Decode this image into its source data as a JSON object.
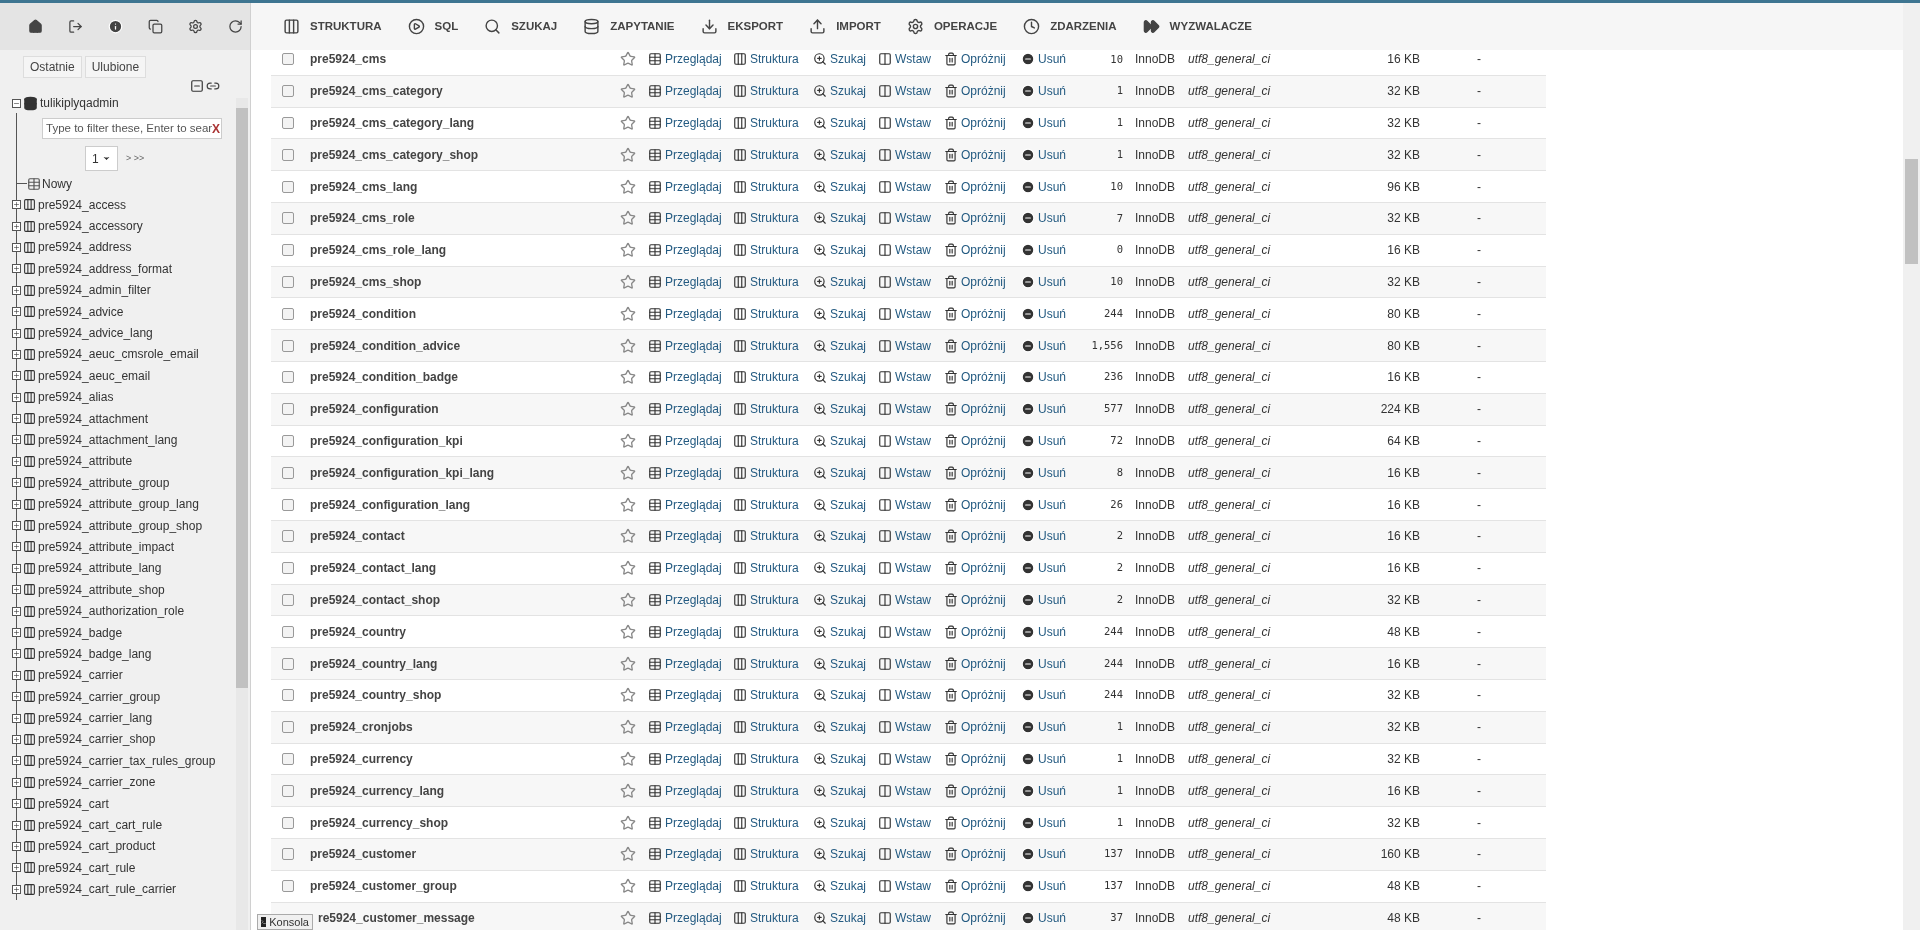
{
  "sidebar": {
    "tabs": [
      {
        "label": "Ostatnie"
      },
      {
        "label": "Ulubione"
      }
    ],
    "database": {
      "name": "tulikiplyqadmin",
      "expanded": true
    },
    "filter": {
      "placeholder": "Type to filter these, Enter to sear",
      "clear": "X"
    },
    "pager": {
      "page": "1",
      "next": "> >>"
    },
    "new_item": "Nowy",
    "tables": [
      {
        "name": "pre5924_access",
        "expanded": false
      },
      {
        "name": "pre5924_accessory",
        "expanded": false
      },
      {
        "name": "pre5924_address",
        "expanded": false
      },
      {
        "name": "pre5924_address_format",
        "expanded": false
      },
      {
        "name": "pre5924_admin_filter",
        "expanded": false
      },
      {
        "name": "pre5924_advice",
        "expanded": false
      },
      {
        "name": "pre5924_advice_lang",
        "expanded": false
      },
      {
        "name": "pre5924_aeuc_cmsrole_email",
        "expanded": false
      },
      {
        "name": "pre5924_aeuc_email",
        "expanded": false
      },
      {
        "name": "pre5924_alias",
        "expanded": false
      },
      {
        "name": "pre5924_attachment",
        "expanded": false
      },
      {
        "name": "pre5924_attachment_lang",
        "expanded": false
      },
      {
        "name": "pre5924_attribute",
        "expanded": false
      },
      {
        "name": "pre5924_attribute_group",
        "expanded": false
      },
      {
        "name": "pre5924_attribute_group_lang",
        "expanded": false
      },
      {
        "name": "pre5924_attribute_group_shop",
        "expanded": false
      },
      {
        "name": "pre5924_attribute_impact",
        "expanded": false
      },
      {
        "name": "pre5924_attribute_lang",
        "expanded": false
      },
      {
        "name": "pre5924_attribute_shop",
        "expanded": false
      },
      {
        "name": "pre5924_authorization_role",
        "expanded": false
      },
      {
        "name": "pre5924_badge",
        "expanded": false
      },
      {
        "name": "pre5924_badge_lang",
        "expanded": false
      },
      {
        "name": "pre5924_carrier",
        "expanded": false
      },
      {
        "name": "pre5924_carrier_group",
        "expanded": false
      },
      {
        "name": "pre5924_carrier_lang",
        "expanded": false
      },
      {
        "name": "pre5924_carrier_shop",
        "expanded": false
      },
      {
        "name": "pre5924_carrier_tax_rules_group",
        "expanded": false
      },
      {
        "name": "pre5924_carrier_zone",
        "expanded": false
      },
      {
        "name": "pre5924_cart",
        "expanded": false
      },
      {
        "name": "pre5924_cart_cart_rule",
        "expanded": false
      },
      {
        "name": "pre5924_cart_product",
        "expanded": false
      },
      {
        "name": "pre5924_cart_rule",
        "expanded": false
      },
      {
        "name": "pre5924_cart_rule_carrier",
        "expanded": false
      }
    ]
  },
  "tabs": [
    {
      "label": "STRUKTURA",
      "kind": "structure",
      "selected": false
    },
    {
      "label": "SQL",
      "kind": "sql",
      "selected": false
    },
    {
      "label": "SZUKAJ",
      "kind": "search",
      "selected": false
    },
    {
      "label": "ZAPYTANIE",
      "kind": "query",
      "selected": false
    },
    {
      "label": "EKSPORT",
      "kind": "export",
      "selected": false
    },
    {
      "label": "IMPORT",
      "kind": "import",
      "selected": false
    },
    {
      "label": "OPERACJE",
      "kind": "operations",
      "selected": false
    },
    {
      "label": "ZDARZENIA",
      "kind": "events",
      "selected": false
    },
    {
      "label": "WYZWALACZE",
      "kind": "triggers",
      "selected": false
    }
  ],
  "table": {
    "rows": [
      {
        "name": "pre5924_cms",
        "checked": false,
        "favorite": false,
        "actions": [
          "Przeglądaj",
          "Struktura",
          "Szukaj",
          "Wstaw",
          "Opróżnij",
          "Usuń"
        ],
        "count": "10",
        "engine": "InnoDB",
        "collation": "utf8_general_ci",
        "size": "16 KB",
        "overhead": "-"
      },
      {
        "name": "pre5924_cms_category",
        "checked": false,
        "favorite": false,
        "actions": [
          "Przeglądaj",
          "Struktura",
          "Szukaj",
          "Wstaw",
          "Opróżnij",
          "Usuń"
        ],
        "count": "1",
        "engine": "InnoDB",
        "collation": "utf8_general_ci",
        "size": "32 KB",
        "overhead": "-"
      },
      {
        "name": "pre5924_cms_category_lang",
        "checked": false,
        "favorite": false,
        "actions": [
          "Przeglądaj",
          "Struktura",
          "Szukaj",
          "Wstaw",
          "Opróżnij",
          "Usuń"
        ],
        "count": "1",
        "engine": "InnoDB",
        "collation": "utf8_general_ci",
        "size": "32 KB",
        "overhead": "-"
      },
      {
        "name": "pre5924_cms_category_shop",
        "checked": false,
        "favorite": false,
        "actions": [
          "Przeglądaj",
          "Struktura",
          "Szukaj",
          "Wstaw",
          "Opróżnij",
          "Usuń"
        ],
        "count": "1",
        "engine": "InnoDB",
        "collation": "utf8_general_ci",
        "size": "32 KB",
        "overhead": "-"
      },
      {
        "name": "pre5924_cms_lang",
        "checked": false,
        "favorite": false,
        "actions": [
          "Przeglądaj",
          "Struktura",
          "Szukaj",
          "Wstaw",
          "Opróżnij",
          "Usuń"
        ],
        "count": "10",
        "engine": "InnoDB",
        "collation": "utf8_general_ci",
        "size": "96 KB",
        "overhead": "-"
      },
      {
        "name": "pre5924_cms_role",
        "checked": false,
        "favorite": false,
        "actions": [
          "Przeglądaj",
          "Struktura",
          "Szukaj",
          "Wstaw",
          "Opróżnij",
          "Usuń"
        ],
        "count": "7",
        "engine": "InnoDB",
        "collation": "utf8_general_ci",
        "size": "32 KB",
        "overhead": "-"
      },
      {
        "name": "pre5924_cms_role_lang",
        "checked": false,
        "favorite": false,
        "actions": [
          "Przeglądaj",
          "Struktura",
          "Szukaj",
          "Wstaw",
          "Opróżnij",
          "Usuń"
        ],
        "count": "0",
        "engine": "InnoDB",
        "collation": "utf8_general_ci",
        "size": "16 KB",
        "overhead": "-"
      },
      {
        "name": "pre5924_cms_shop",
        "checked": false,
        "favorite": false,
        "actions": [
          "Przeglądaj",
          "Struktura",
          "Szukaj",
          "Wstaw",
          "Opróżnij",
          "Usuń"
        ],
        "count": "10",
        "engine": "InnoDB",
        "collation": "utf8_general_ci",
        "size": "32 KB",
        "overhead": "-"
      },
      {
        "name": "pre5924_condition",
        "checked": false,
        "favorite": false,
        "actions": [
          "Przeglądaj",
          "Struktura",
          "Szukaj",
          "Wstaw",
          "Opróżnij",
          "Usuń"
        ],
        "count": "244",
        "engine": "InnoDB",
        "collation": "utf8_general_ci",
        "size": "80 KB",
        "overhead": "-"
      },
      {
        "name": "pre5924_condition_advice",
        "checked": false,
        "favorite": false,
        "actions": [
          "Przeglądaj",
          "Struktura",
          "Szukaj",
          "Wstaw",
          "Opróżnij",
          "Usuń"
        ],
        "count": "1,556",
        "engine": "InnoDB",
        "collation": "utf8_general_ci",
        "size": "80 KB",
        "overhead": "-"
      },
      {
        "name": "pre5924_condition_badge",
        "checked": false,
        "favorite": false,
        "actions": [
          "Przeglądaj",
          "Struktura",
          "Szukaj",
          "Wstaw",
          "Opróżnij",
          "Usuń"
        ],
        "count": "236",
        "engine": "InnoDB",
        "collation": "utf8_general_ci",
        "size": "16 KB",
        "overhead": "-"
      },
      {
        "name": "pre5924_configuration",
        "checked": false,
        "favorite": false,
        "actions": [
          "Przeglądaj",
          "Struktura",
          "Szukaj",
          "Wstaw",
          "Opróżnij",
          "Usuń"
        ],
        "count": "577",
        "engine": "InnoDB",
        "collation": "utf8_general_ci",
        "size": "224 KB",
        "overhead": "-"
      },
      {
        "name": "pre5924_configuration_kpi",
        "checked": false,
        "favorite": false,
        "actions": [
          "Przeglądaj",
          "Struktura",
          "Szukaj",
          "Wstaw",
          "Opróżnij",
          "Usuń"
        ],
        "count": "72",
        "engine": "InnoDB",
        "collation": "utf8_general_ci",
        "size": "64 KB",
        "overhead": "-"
      },
      {
        "name": "pre5924_configuration_kpi_lang",
        "checked": false,
        "favorite": false,
        "actions": [
          "Przeglądaj",
          "Struktura",
          "Szukaj",
          "Wstaw",
          "Opróżnij",
          "Usuń"
        ],
        "count": "8",
        "engine": "InnoDB",
        "collation": "utf8_general_ci",
        "size": "16 KB",
        "overhead": "-"
      },
      {
        "name": "pre5924_configuration_lang",
        "checked": false,
        "favorite": false,
        "actions": [
          "Przeglądaj",
          "Struktura",
          "Szukaj",
          "Wstaw",
          "Opróżnij",
          "Usuń"
        ],
        "count": "26",
        "engine": "InnoDB",
        "collation": "utf8_general_ci",
        "size": "16 KB",
        "overhead": "-"
      },
      {
        "name": "pre5924_contact",
        "checked": false,
        "favorite": false,
        "actions": [
          "Przeglądaj",
          "Struktura",
          "Szukaj",
          "Wstaw",
          "Opróżnij",
          "Usuń"
        ],
        "count": "2",
        "engine": "InnoDB",
        "collation": "utf8_general_ci",
        "size": "16 KB",
        "overhead": "-"
      },
      {
        "name": "pre5924_contact_lang",
        "checked": false,
        "favorite": false,
        "actions": [
          "Przeglądaj",
          "Struktura",
          "Szukaj",
          "Wstaw",
          "Opróżnij",
          "Usuń"
        ],
        "count": "2",
        "engine": "InnoDB",
        "collation": "utf8_general_ci",
        "size": "16 KB",
        "overhead": "-"
      },
      {
        "name": "pre5924_contact_shop",
        "checked": false,
        "favorite": false,
        "actions": [
          "Przeglądaj",
          "Struktura",
          "Szukaj",
          "Wstaw",
          "Opróżnij",
          "Usuń"
        ],
        "count": "2",
        "engine": "InnoDB",
        "collation": "utf8_general_ci",
        "size": "32 KB",
        "overhead": "-"
      },
      {
        "name": "pre5924_country",
        "checked": false,
        "favorite": false,
        "actions": [
          "Przeglądaj",
          "Struktura",
          "Szukaj",
          "Wstaw",
          "Opróżnij",
          "Usuń"
        ],
        "count": "244",
        "engine": "InnoDB",
        "collation": "utf8_general_ci",
        "size": "48 KB",
        "overhead": "-"
      },
      {
        "name": "pre5924_country_lang",
        "checked": false,
        "favorite": false,
        "actions": [
          "Przeglądaj",
          "Struktura",
          "Szukaj",
          "Wstaw",
          "Opróżnij",
          "Usuń"
        ],
        "count": "244",
        "engine": "InnoDB",
        "collation": "utf8_general_ci",
        "size": "16 KB",
        "overhead": "-"
      },
      {
        "name": "pre5924_country_shop",
        "checked": false,
        "favorite": false,
        "actions": [
          "Przeglądaj",
          "Struktura",
          "Szukaj",
          "Wstaw",
          "Opróżnij",
          "Usuń"
        ],
        "count": "244",
        "engine": "InnoDB",
        "collation": "utf8_general_ci",
        "size": "32 KB",
        "overhead": "-"
      },
      {
        "name": "pre5924_cronjobs",
        "checked": false,
        "favorite": false,
        "actions": [
          "Przeglądaj",
          "Struktura",
          "Szukaj",
          "Wstaw",
          "Opróżnij",
          "Usuń"
        ],
        "count": "1",
        "engine": "InnoDB",
        "collation": "utf8_general_ci",
        "size": "32 KB",
        "overhead": "-"
      },
      {
        "name": "pre5924_currency",
        "checked": false,
        "favorite": false,
        "actions": [
          "Przeglądaj",
          "Struktura",
          "Szukaj",
          "Wstaw",
          "Opróżnij",
          "Usuń"
        ],
        "count": "1",
        "engine": "InnoDB",
        "collation": "utf8_general_ci",
        "size": "32 KB",
        "overhead": "-"
      },
      {
        "name": "pre5924_currency_lang",
        "checked": false,
        "favorite": false,
        "actions": [
          "Przeglądaj",
          "Struktura",
          "Szukaj",
          "Wstaw",
          "Opróżnij",
          "Usuń"
        ],
        "count": "1",
        "engine": "InnoDB",
        "collation": "utf8_general_ci",
        "size": "16 KB",
        "overhead": "-"
      },
      {
        "name": "pre5924_currency_shop",
        "checked": false,
        "favorite": false,
        "actions": [
          "Przeglądaj",
          "Struktura",
          "Szukaj",
          "Wstaw",
          "Opróżnij",
          "Usuń"
        ],
        "count": "1",
        "engine": "InnoDB",
        "collation": "utf8_general_ci",
        "size": "32 KB",
        "overhead": "-"
      },
      {
        "name": "pre5924_customer",
        "checked": false,
        "favorite": false,
        "actions": [
          "Przeglądaj",
          "Struktura",
          "Szukaj",
          "Wstaw",
          "Opróżnij",
          "Usuń"
        ],
        "count": "137",
        "engine": "InnoDB",
        "collation": "utf8_general_ci",
        "size": "160 KB",
        "overhead": "-"
      },
      {
        "name": "pre5924_customer_group",
        "checked": false,
        "favorite": false,
        "actions": [
          "Przeglądaj",
          "Struktura",
          "Szukaj",
          "Wstaw",
          "Opróżnij",
          "Usuń"
        ],
        "count": "137",
        "engine": "InnoDB",
        "collation": "utf8_general_ci",
        "size": "48 KB",
        "overhead": "-"
      },
      {
        "name": "re5924_customer_message",
        "favorite": false,
        "actions": [
          "Przeglądaj",
          "Struktura",
          "Szukaj",
          "Wstaw",
          "Opróżnij",
          "Usuń"
        ],
        "count": "37",
        "engine": "InnoDB",
        "collation": "utf8_general_ci",
        "size": "48 KB",
        "overhead": "-"
      }
    ]
  },
  "console": {
    "label": "Konsola"
  }
}
